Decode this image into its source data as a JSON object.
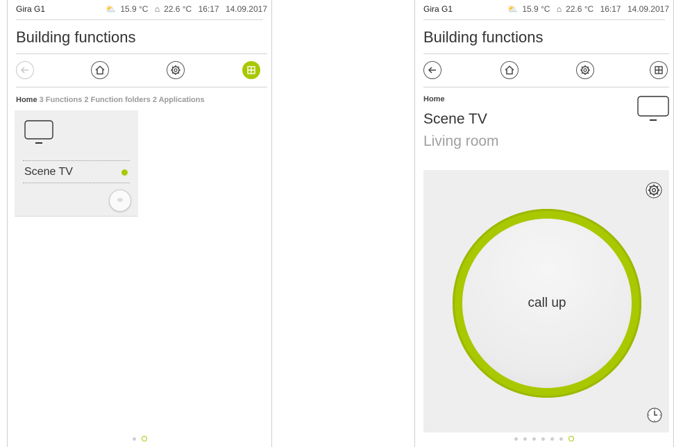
{
  "status": {
    "device": "Gira G1",
    "temp_outside": "15.9 °C",
    "temp_inside": "22.6 °C",
    "time": "16:17",
    "date": "14.09.2017"
  },
  "screen1": {
    "title": "Building functions",
    "breadcrumb": {
      "home": "Home",
      "items": [
        "3 Functions",
        "2 Function folders",
        "2 Applications"
      ]
    },
    "tile": {
      "label": "Scene TV",
      "led_color": "#a9c800"
    },
    "page_dots": 2,
    "page_active": 2
  },
  "screen2": {
    "title": "Building functions",
    "breadcrumb_home": "Home",
    "function_name": "Scene TV",
    "room": "Living room",
    "button_label": "call up",
    "page_dots": 7,
    "page_active": 7
  },
  "colors": {
    "accent": "#a9c800"
  },
  "icons": [
    "back-arrow-icon",
    "home-icon",
    "gear-icon",
    "grid-icon",
    "tv-icon",
    "clock-icon"
  ]
}
